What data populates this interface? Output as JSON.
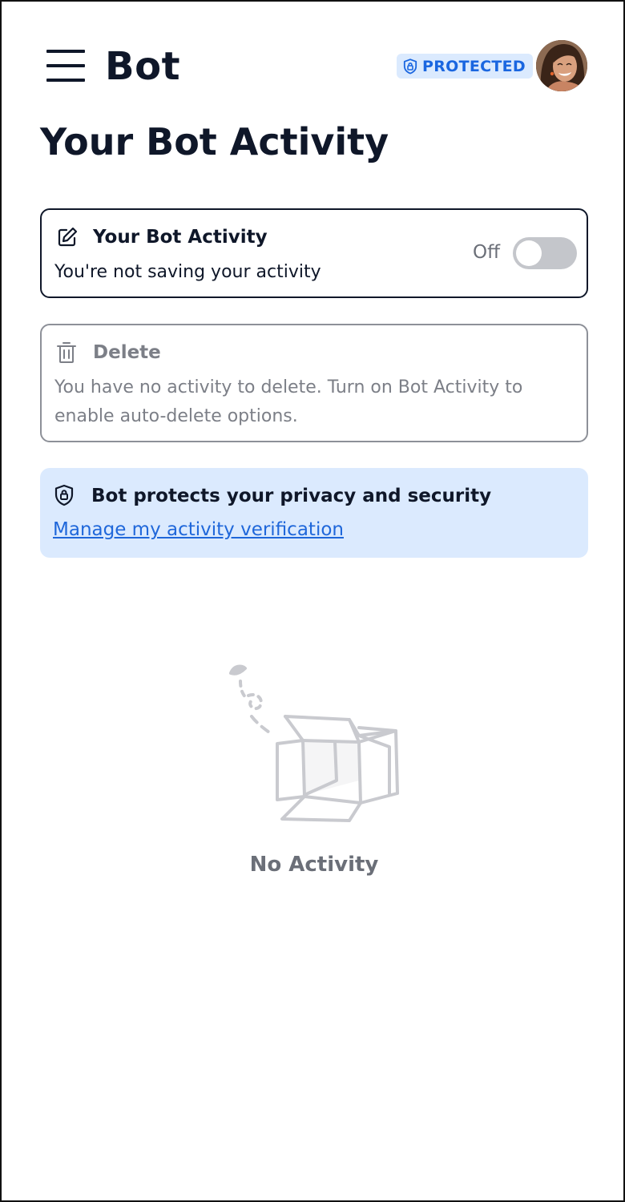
{
  "header": {
    "app_title": "Bot",
    "badge_label": "PROTECTED",
    "menu_icon": "hamburger-menu-icon",
    "avatar_icon": "user-avatar"
  },
  "page": {
    "title": "Your Bot Activity"
  },
  "activity_card": {
    "icon": "edit-icon",
    "heading": "Your Bot Activity",
    "description": "You're not saving your activity",
    "toggle_label": "Off",
    "toggle_on": false
  },
  "delete_card": {
    "icon": "trash-icon",
    "heading": "Delete",
    "description": "You have no activity to delete. Turn on Bot Activity to enable auto-delete options."
  },
  "privacy_card": {
    "icon": "shield-lock-icon",
    "heading": "Bot protects your privacy and security",
    "link_text": "Manage my activity verification"
  },
  "empty_state": {
    "icon": "empty-box-illustration",
    "text": "No Activity"
  },
  "colors": {
    "text_primary": "#0f1729",
    "text_muted": "#7c7f87",
    "accent": "#1a66e0",
    "badge_bg": "#dbeafe",
    "toggle_off": "#c4c6cb"
  }
}
